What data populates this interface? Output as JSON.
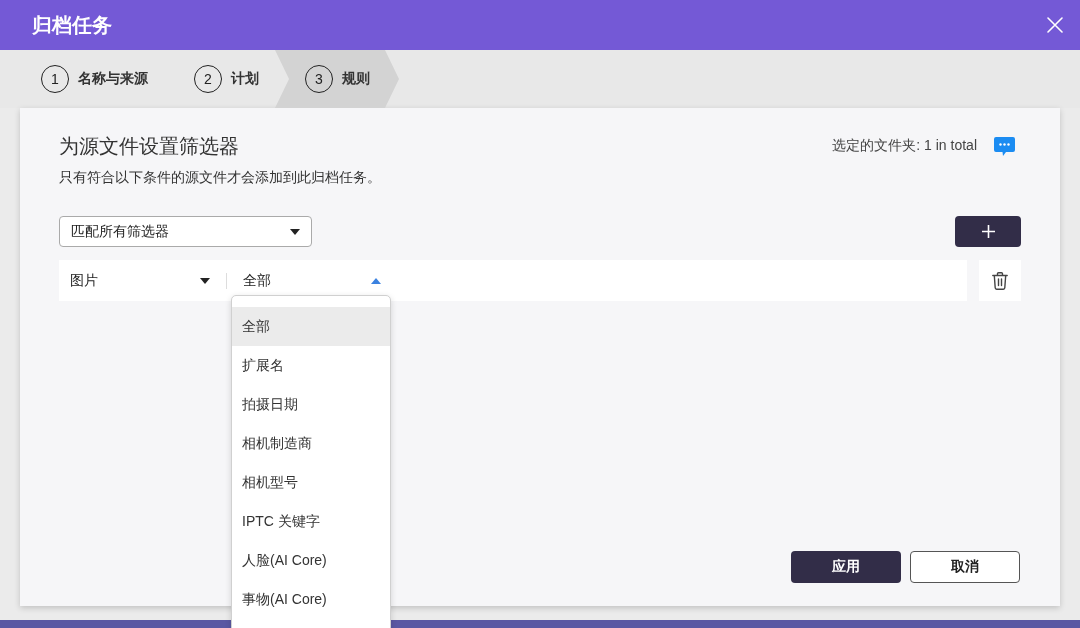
{
  "window": {
    "title": "归档任务"
  },
  "steps": [
    {
      "number": "1",
      "label": "名称与来源",
      "selected": false
    },
    {
      "number": "2",
      "label": "计划",
      "selected": false
    },
    {
      "number": "3",
      "label": "规则",
      "selected": true
    }
  ],
  "filter_panel": {
    "heading": "为源文件设置筛选器",
    "description": "只有符合以下条件的源文件才会添加到此归档任务。",
    "selected_folders": "选定的文件夹: 1 in total",
    "match_mode": {
      "value": "匹配所有筛选器",
      "expanded": false
    }
  },
  "filters": [
    {
      "type": {
        "value": "图片",
        "expanded": false
      },
      "condition": {
        "value": "全部",
        "expanded": true,
        "options": [
          {
            "label": "全部",
            "selected": true
          },
          {
            "label": "扩展名",
            "selected": false
          },
          {
            "label": "拍摄日期",
            "selected": false
          },
          {
            "label": "相机制造商",
            "selected": false
          },
          {
            "label": "相机型号",
            "selected": false
          },
          {
            "label": "IPTC 关键字",
            "selected": false
          },
          {
            "label": "人脸(AI Core)",
            "selected": false
          },
          {
            "label": "事物(AI Core)",
            "selected": false
          }
        ]
      }
    }
  ],
  "buttons": [
    {
      "label": "应用",
      "kind": "primary"
    },
    {
      "label": "取消",
      "kind": "secondary"
    }
  ]
}
